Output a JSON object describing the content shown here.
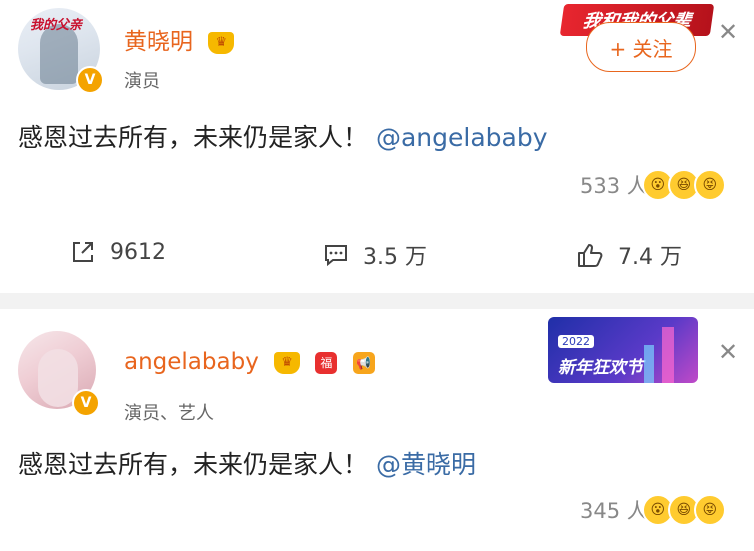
{
  "post1": {
    "avatar_text": "我的父亲",
    "username": "黄晓明",
    "role": "演员",
    "follow_label": "+ 关注",
    "banner_text": "我和我的父辈",
    "content_text": "感恩过去所有，未来仍是家人！",
    "content_mention": "@angelababy",
    "reactions_count": "533 人",
    "share_count": "9612",
    "comment_count": "3.5 万",
    "like_count": "7.4 万"
  },
  "post2": {
    "username": "angelababy",
    "role": "演员、艺人",
    "festival_year": "2022",
    "festival_title": "新年狂欢节",
    "content_text": "感恩过去所有，未来仍是家人！",
    "content_mention": "@黄晓明",
    "reactions_count": "345 人"
  },
  "colors": {
    "username": "#e8651e",
    "mention": "#3a6ba5",
    "verified_badge": "#f4a300"
  },
  "icons": [
    "crown-icon",
    "verified-icon",
    "close-icon",
    "share-icon",
    "comment-icon",
    "like-icon",
    "emoji-surprised-icon",
    "emoji-laugh-icon",
    "red-packet-icon",
    "megaphone-icon"
  ]
}
